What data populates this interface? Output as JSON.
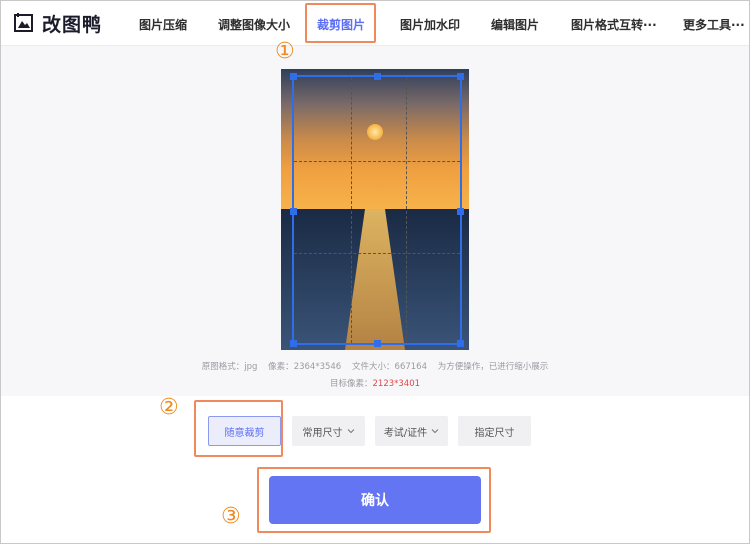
{
  "app": {
    "logo_text": "改图鸭",
    "brand_color": "#5b6ef5",
    "highlight_color": "#f08a5c"
  },
  "nav": {
    "items": [
      {
        "label": "图片压缩"
      },
      {
        "label": "调整图像大小"
      },
      {
        "label": "裁剪图片",
        "active": true
      },
      {
        "label": "图片加水印"
      },
      {
        "label": "编辑图片"
      },
      {
        "label": "图片格式互转···"
      },
      {
        "label": "更多工具···"
      }
    ]
  },
  "image_info": {
    "format_label": "原图格式：",
    "format_value": "jpg",
    "pixels_label": "像素：",
    "pixels_value": "2364*3546",
    "size_label": "文件大小：",
    "size_value": "667164",
    "note": "为方便操作，已进行缩小展示",
    "target_label": "目标像素：",
    "target_value": "2123*3401"
  },
  "crop_options": {
    "free": "随意裁剪",
    "common": "常用尺寸",
    "exam": "考试/证件",
    "custom": "指定尺寸"
  },
  "confirm_label": "确认",
  "steps": {
    "one": "①",
    "two": "②",
    "three": "③"
  }
}
